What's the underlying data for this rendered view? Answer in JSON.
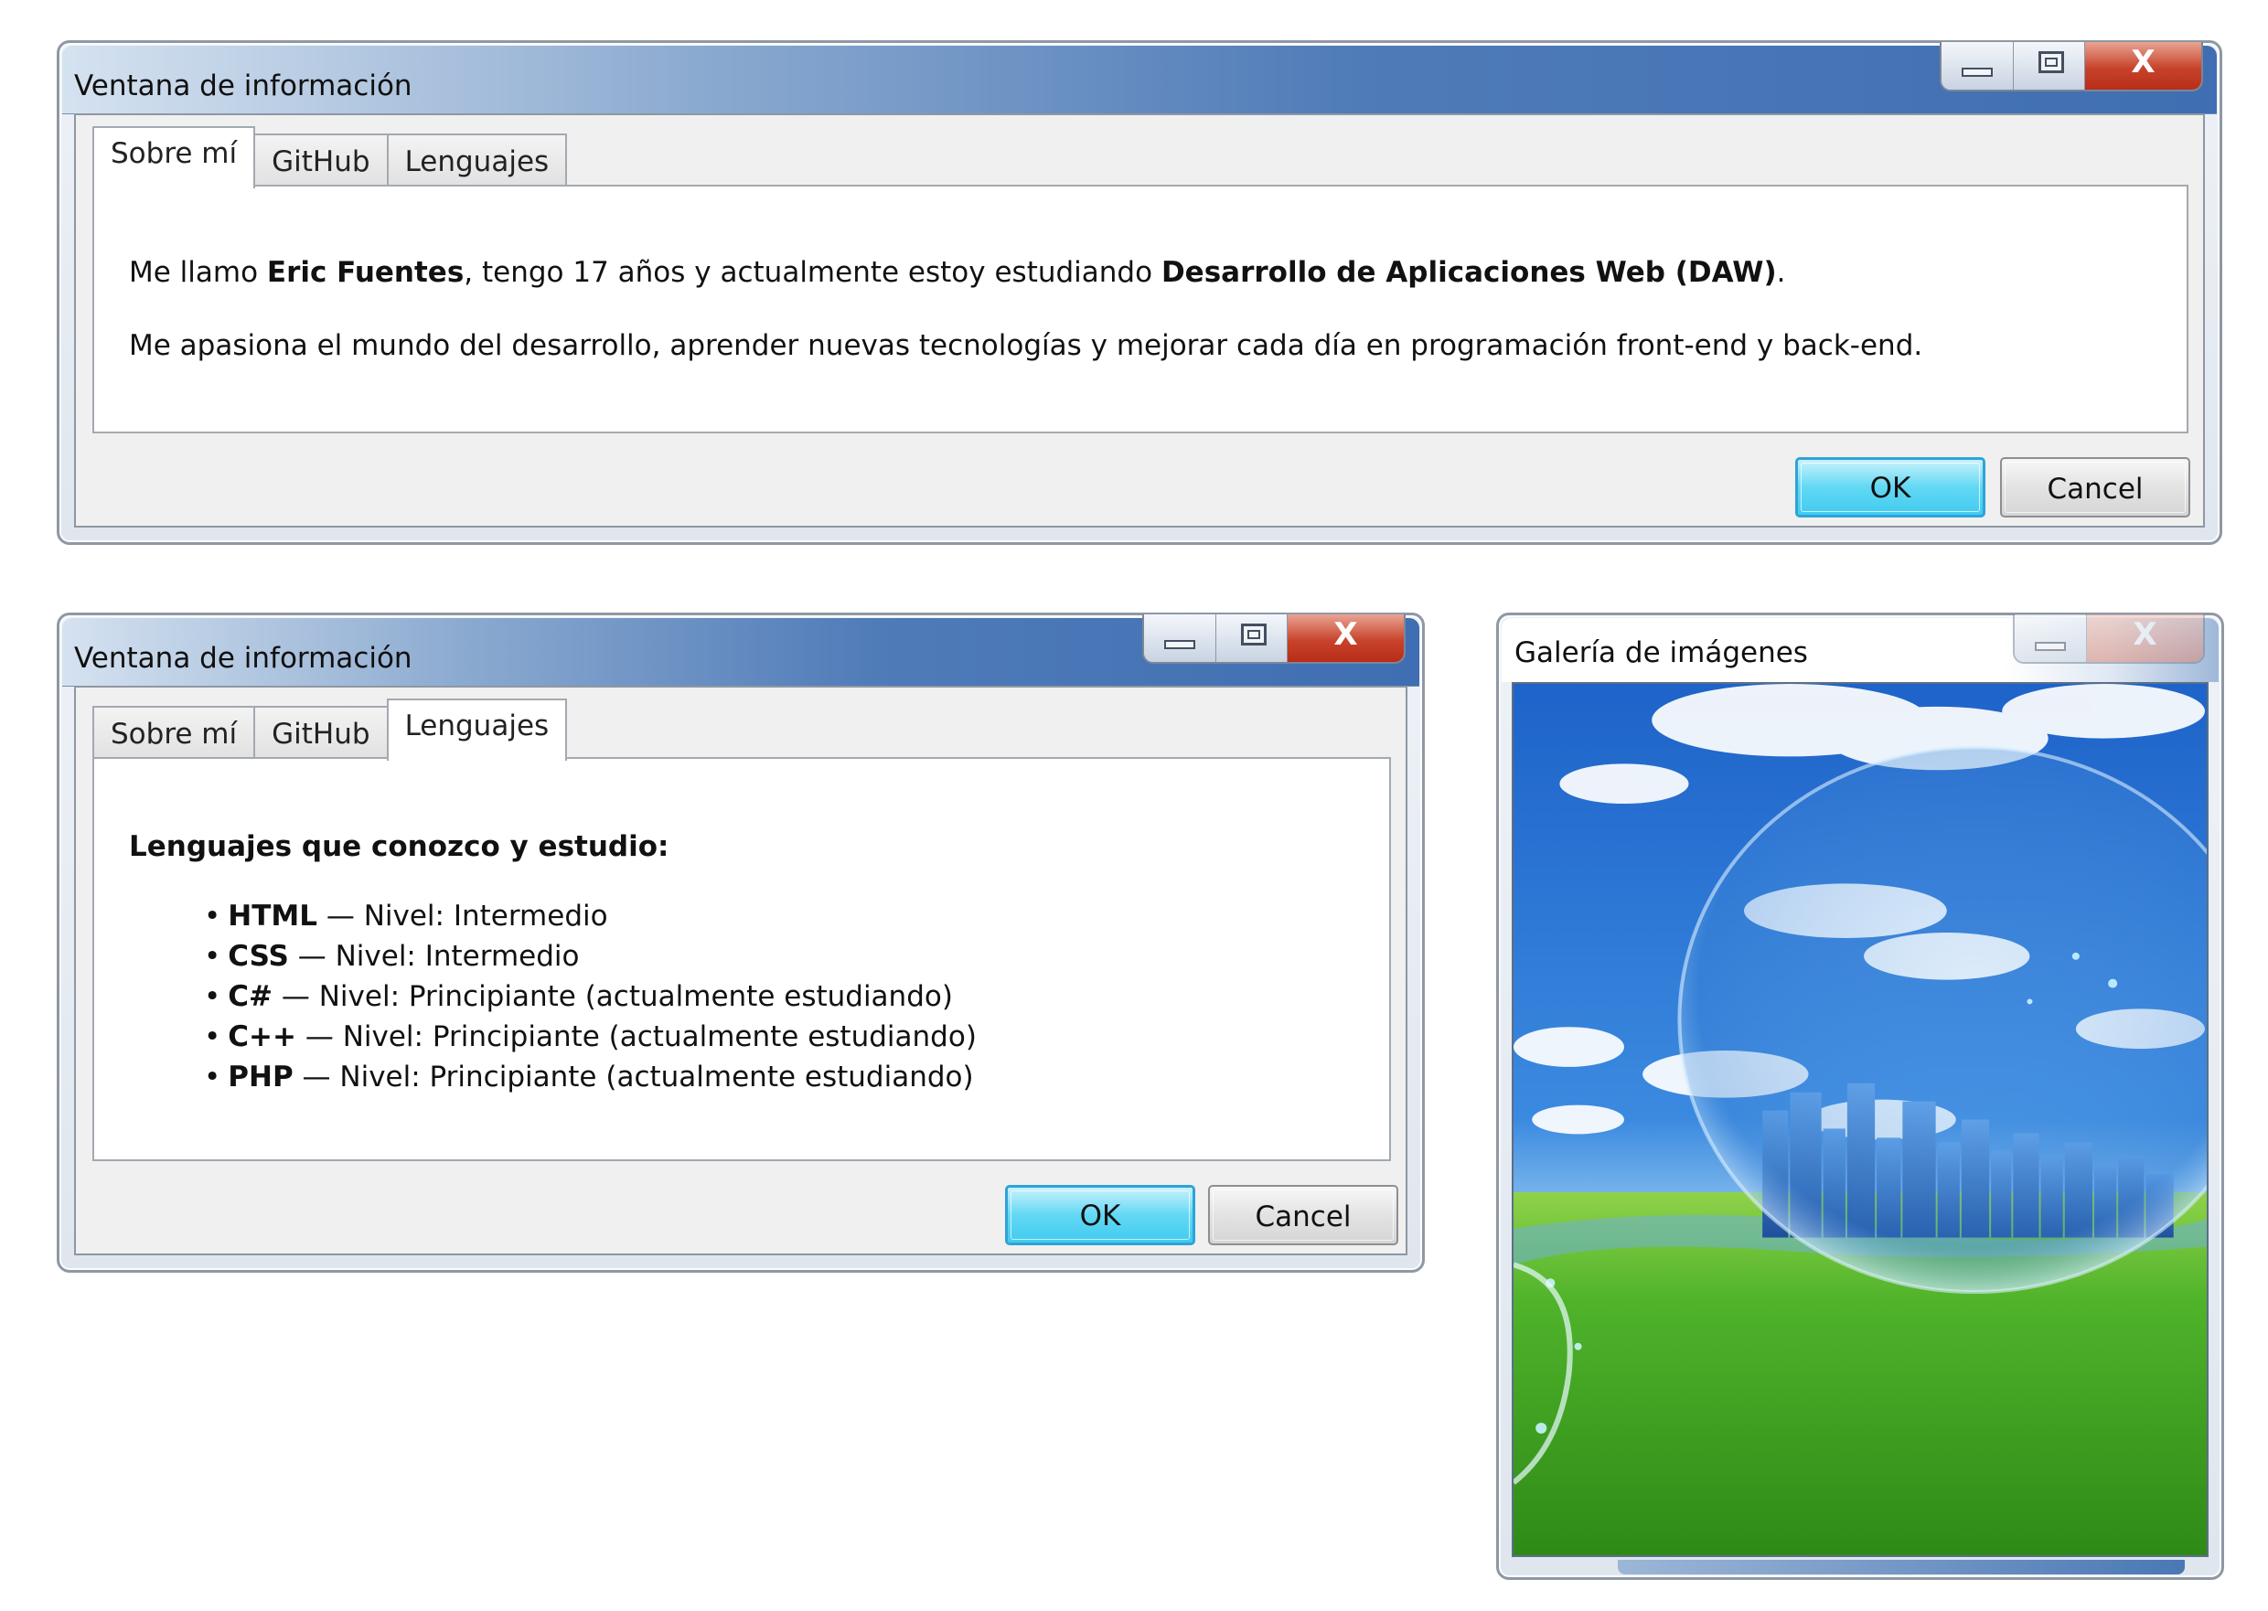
{
  "window_about": {
    "title": "Ventana de información",
    "tabs": [
      {
        "label": "Sobre mí"
      },
      {
        "label": "GitHub"
      },
      {
        "label": "Lenguajes"
      }
    ],
    "active_tab": "Sobre mí",
    "paragraph1": {
      "p1": "Me llamo ",
      "name": "Eric Fuentes",
      "p2": ", tengo 17 años y actualmente estoy estudiando ",
      "course": "Desarrollo de Aplicaciones Web (DAW)",
      "p3": "."
    },
    "paragraph2": "Me apasiona el mundo del desarrollo, aprender nuevas tecnologías y mejorar cada día en programación front-end y back-end.",
    "ok_label": "OK",
    "cancel_label": "Cancel"
  },
  "window_languages": {
    "title": "Ventana de información",
    "tabs": [
      {
        "label": "Sobre mí"
      },
      {
        "label": "GitHub"
      },
      {
        "label": "Lenguajes"
      }
    ],
    "active_tab": "Lenguajes",
    "heading": "Lenguajes que conozco y estudio:",
    "bullet": "•",
    "languages": [
      {
        "name": "HTML",
        "level": " — Nivel: Intermedio"
      },
      {
        "name": "CSS",
        "level": " — Nivel: Intermedio"
      },
      {
        "name": "C#",
        "level": " — Nivel: Principiante (actualmente estudiando)"
      },
      {
        "name": "C++",
        "level": " — Nivel: Principiante (actualmente estudiando)"
      },
      {
        "name": "PHP",
        "level": " — Nivel: Principiante (actualmente estudiando)"
      }
    ],
    "ok_label": "OK",
    "cancel_label": "Cancel"
  },
  "window_gallery": {
    "title": "Galería de imágenes",
    "image_subject": "fantasy city skyline inside a glass sphere over a green meadow with blue cloudy sky"
  },
  "caption_icons": {
    "minimize": "minimize-icon",
    "maximize": "maximize-icon",
    "close": "close-icon",
    "close_glyph": "X"
  },
  "colors": {
    "titlebar_blue": "#3f6eb2",
    "default_button": "#41cbef",
    "close_button": "#c8432b"
  }
}
